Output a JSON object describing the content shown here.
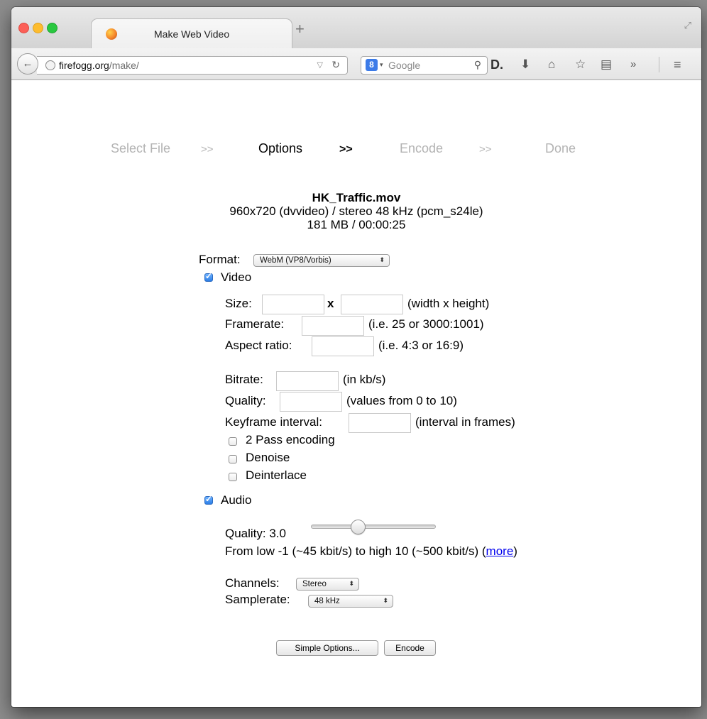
{
  "browser": {
    "tab_title": "Make Web Video",
    "new_tab": "+",
    "url_domain": "firefogg.org",
    "url_path": "/make/",
    "search_engine": "8",
    "search_placeholder": "Google"
  },
  "steps": {
    "select_file": "Select File",
    "sep1": ">>",
    "options": "Options",
    "sep2": ">>",
    "encode": "Encode",
    "sep3": ">>",
    "done": "Done"
  },
  "file": {
    "name": "HK_Traffic.mov",
    "details": "960x720 (dvvideo) / stereo 48 kHz (pcm_s24le)",
    "size_duration": "181 MB / 00:00:25"
  },
  "form": {
    "format_label": "Format:",
    "format_value": "WebM (VP8/Vorbis)",
    "video_label": "Video",
    "video_checked": true,
    "size_label": "Size:",
    "size_x": "x",
    "size_hint": "(width x height)",
    "framerate_label": "Framerate:",
    "framerate_hint": "(i.e. 25 or 3000:1001)",
    "aspect_label": "Aspect ratio:",
    "aspect_hint": "(i.e. 4:3 or 16:9)",
    "bitrate_label": "Bitrate:",
    "bitrate_hint": "(in kb/s)",
    "quality_label": "Quality:",
    "quality_hint": "(values from 0 to 10)",
    "keyframe_label": "Keyframe interval:",
    "keyframe_hint": "(interval in frames)",
    "twopass_label": "2 Pass encoding",
    "denoise_label": "Denoise",
    "deinterlace_label": "Deinterlace",
    "audio_label": "Audio",
    "audio_checked": true,
    "audio_quality_label": "Quality: 3.0",
    "audio_quality_value": 3.0,
    "audio_range_text": "From low -1 (~45 kbit/s) to high 10 (~500 kbit/s) (",
    "more_link": "more",
    "audio_range_close": ")",
    "channels_label": "Channels:",
    "channels_value": "Stereo",
    "samplerate_label": "Samplerate:",
    "samplerate_value": "48 kHz",
    "simple_options_button": "Simple Options...",
    "encode_button": "Encode"
  }
}
